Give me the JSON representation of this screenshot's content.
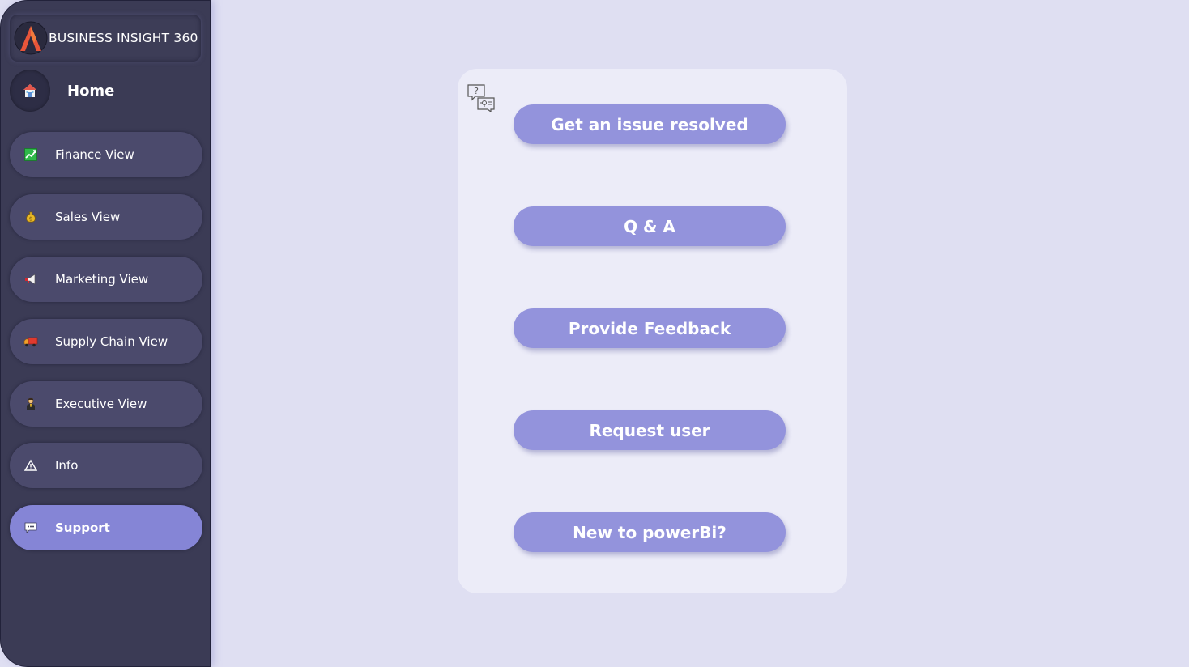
{
  "brand": {
    "title": "BUSINESS INSIGHT 360"
  },
  "home": {
    "label": "Home",
    "icon": "home-icon"
  },
  "nav": [
    {
      "label": "Finance View",
      "icon": "chart-up-icon",
      "active": false
    },
    {
      "label": "Sales View",
      "icon": "money-bag-icon",
      "active": false
    },
    {
      "label": "Marketing View",
      "icon": "megaphone-icon",
      "active": false
    },
    {
      "label": "Supply Chain View",
      "icon": "truck-icon",
      "active": false
    },
    {
      "label": "Executive View",
      "icon": "executive-icon",
      "active": false
    },
    {
      "label": "Info",
      "icon": "warning-icon",
      "active": false
    },
    {
      "label": "Support",
      "icon": "chat-bubble-icon",
      "active": true
    }
  ],
  "support": {
    "icon": "question-chat-icon",
    "actions": [
      {
        "label": "Get an issue resolved"
      },
      {
        "label": "Q & A"
      },
      {
        "label": "Provide Feedback"
      },
      {
        "label": "Request user"
      },
      {
        "label": "New to powerBi?"
      }
    ]
  },
  "colors": {
    "page_bg": "#dfdff2",
    "sidebar_bg": "#3b3b55",
    "nav_item_bg": "#4b4a6c",
    "nav_active_bg": "#8585d6",
    "panel_bg": "#ececf8",
    "action_btn_bg": "#9393dc"
  }
}
